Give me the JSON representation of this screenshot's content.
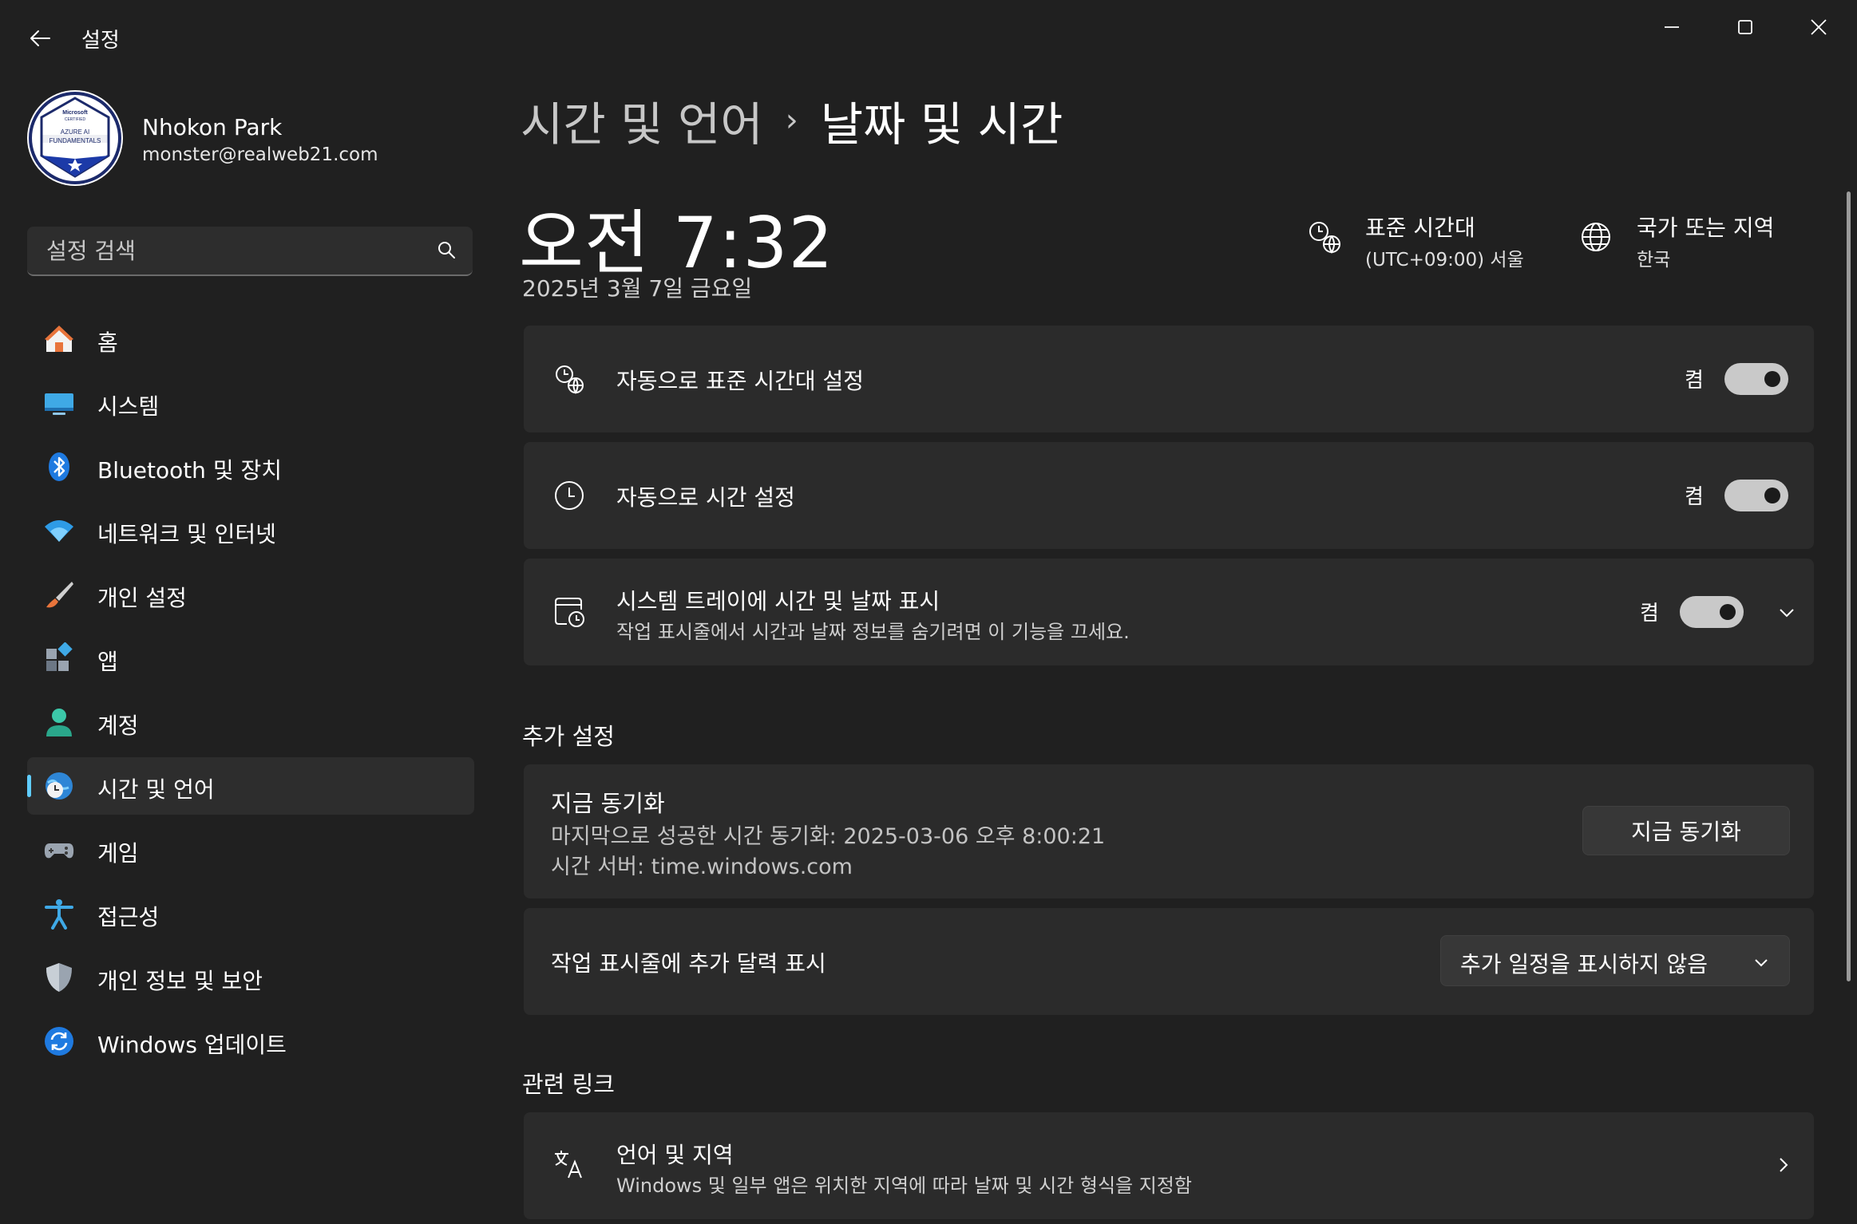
{
  "window": {
    "title": "설정",
    "back_icon": "arrow-left-icon",
    "controls": [
      "minimize-icon",
      "maximize-icon",
      "close-icon"
    ]
  },
  "profile": {
    "name": "Nhokon Park",
    "email": "monster@realweb21.com",
    "badge": {
      "line1": "Microsoft",
      "line2": "CERTIFIED",
      "line3": "AZURE AI",
      "line4": "FUNDAMENTALS"
    }
  },
  "search": {
    "placeholder": "설정 검색"
  },
  "nav": {
    "items": [
      {
        "label": "홈",
        "icon": "home-icon"
      },
      {
        "label": "시스템",
        "icon": "monitor-icon"
      },
      {
        "label": "Bluetooth 및 장치",
        "icon": "bluetooth-icon"
      },
      {
        "label": "네트워크 및 인터넷",
        "icon": "wifi-icon"
      },
      {
        "label": "개인 설정",
        "icon": "brush-icon"
      },
      {
        "label": "앱",
        "icon": "apps-icon"
      },
      {
        "label": "계정",
        "icon": "person-icon"
      },
      {
        "label": "시간 및 언어",
        "icon": "globe-clock-icon",
        "active": true
      },
      {
        "label": "게임",
        "icon": "gamepad-icon"
      },
      {
        "label": "접근성",
        "icon": "accessibility-icon"
      },
      {
        "label": "개인 정보 및 보안",
        "icon": "shield-icon"
      },
      {
        "label": "Windows 업데이트",
        "icon": "update-icon"
      }
    ]
  },
  "breadcrumb": {
    "parent": "시간 및 언어",
    "separator": "›",
    "current": "날짜 및 시간"
  },
  "clock": {
    "time": "오전 7:32",
    "date": "2025년 3월 7일 금요일"
  },
  "timezone": {
    "title": "표준 시간대",
    "value": "(UTC+09:00) 서울"
  },
  "region": {
    "title": "국가 또는 지역",
    "value": "한국"
  },
  "settings": {
    "auto_timezone": {
      "title": "자동으로 표준 시간대 설정",
      "state": "켬",
      "on": true
    },
    "auto_time": {
      "title": "자동으로 시간 설정",
      "state": "켬",
      "on": true
    },
    "tray": {
      "title": "시스템 트레이에 시간 및 날짜 표시",
      "subtitle": "작업 표시줄에서 시간과 날짜 정보를 숨기려면 이 기능을 끄세요.",
      "state": "켬",
      "on": true
    }
  },
  "additional": {
    "section_title": "추가 설정",
    "sync": {
      "title": "지금 동기화",
      "last_sync": "마지막으로 성공한 시간 동기화: 2025-03-06 오후 8:00:21",
      "server": "시간 서버: time.windows.com",
      "button": "지금 동기화"
    },
    "calendar": {
      "title": "작업 표시줄에 추가 달력 표시",
      "selected": "추가 일정을 표시하지 않음"
    }
  },
  "related": {
    "section_title": "관련 링크",
    "language_region": {
      "title": "언어 및 지역",
      "subtitle": "Windows 및 일부 앱은 위치한 지역에 따라 날짜 및 시간 형식을 지정함"
    }
  },
  "colors": {
    "accent": "#60cdff",
    "background": "#202020",
    "card": "#2b2b2b"
  }
}
